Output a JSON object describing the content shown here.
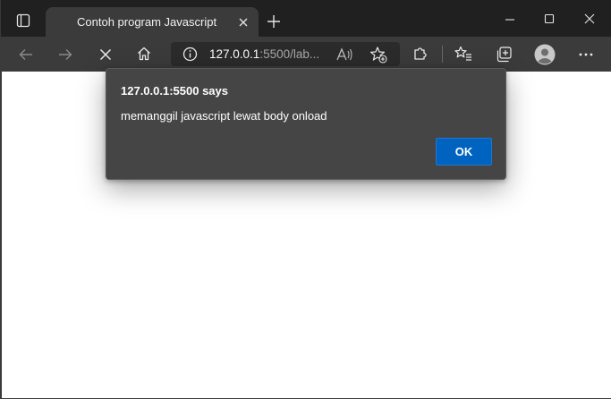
{
  "browser": {
    "tab": {
      "title": "Contoh program Javascript"
    },
    "address_bar": {
      "host": "127.0.0.1",
      "path": ":5500/lab..."
    }
  },
  "dialog": {
    "title": "127.0.0.1:5500 says",
    "message": "memanggil javascript lewat body onload",
    "ok_label": "OK"
  },
  "icons": {
    "tab_actions": "tab-actions-icon",
    "new_tab": "plus-icon",
    "minimize": "minimize-icon",
    "maximize": "maximize-icon",
    "close": "close-icon",
    "back": "back-arrow-icon",
    "forward": "forward-arrow-icon",
    "stop": "stop-icon",
    "home": "home-icon",
    "site_info": "info-icon",
    "read_aloud": "read-aloud-icon",
    "add_favorite": "add-favorite-icon",
    "extensions": "puzzle-icon",
    "favorites": "favorites-icon",
    "collections": "collections-icon",
    "profile": "profile-avatar-icon",
    "more": "more-icon"
  },
  "colors": {
    "titlebar": "#202020",
    "toolbar": "#3b3b3b",
    "dialog_bg": "#454545",
    "ok_button": "#0063bf"
  }
}
